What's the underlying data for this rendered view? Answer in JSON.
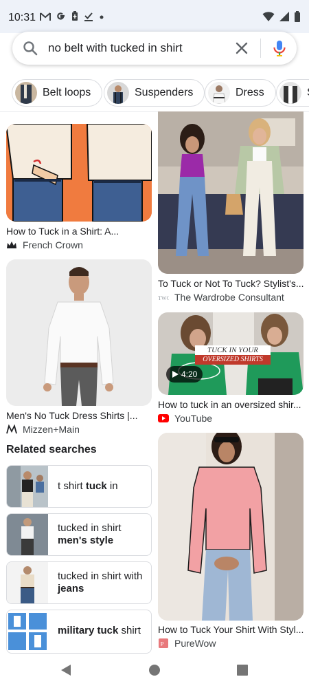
{
  "status_bar": {
    "time": "10:31",
    "left_icons": [
      "gmail-icon",
      "google-icon",
      "battery-saver-icon",
      "download-done-icon",
      "dot-icon"
    ],
    "right_icons": [
      "wifi-icon",
      "signal-icon",
      "battery-icon"
    ]
  },
  "search": {
    "query": "no belt with tucked in shirt",
    "icons": [
      "search-icon",
      "clear-icon",
      "mic-icon"
    ]
  },
  "chips": [
    {
      "label": "Belt loops"
    },
    {
      "label": "Suspenders"
    },
    {
      "label": "Dress"
    },
    {
      "label": "S"
    }
  ],
  "results": {
    "left": [
      {
        "title": "How to Tuck in a Shirt: A...",
        "source": "French Crown"
      },
      {
        "title": "Men's No Tuck Dress Shirts |...",
        "source": "Mizzen+Main"
      }
    ],
    "right": [
      {
        "title": "To Tuck or Not To Tuck? Stylist's...",
        "source": "The Wardrobe Consultant"
      },
      {
        "title": "How to tuck in an oversized shir...",
        "source": "YouTube",
        "duration": "4:20",
        "overlay_line1": "TUCK IN YOUR",
        "overlay_line2": "OVERSIZED SHIRTS"
      },
      {
        "title": "How to Tuck Your Shirt With Styl...",
        "source": "PureWow"
      }
    ]
  },
  "related": {
    "title": "Related searches",
    "items": [
      {
        "pre": "t shirt ",
        "bold": "tuck",
        "post": " in"
      },
      {
        "pre": "tucked in shirt ",
        "bold": "men's style",
        "post": ""
      },
      {
        "pre": "tucked in shirt with ",
        "bold": "jeans",
        "post": ""
      },
      {
        "pre": "",
        "bold": "military tuck",
        "post": " shirt"
      }
    ]
  },
  "colors": {
    "status_bar_bg": "#eef2f9",
    "mic_blue": "#4285f4",
    "youtube_red": "#ff0000",
    "card_orange": "#f07b3f"
  }
}
